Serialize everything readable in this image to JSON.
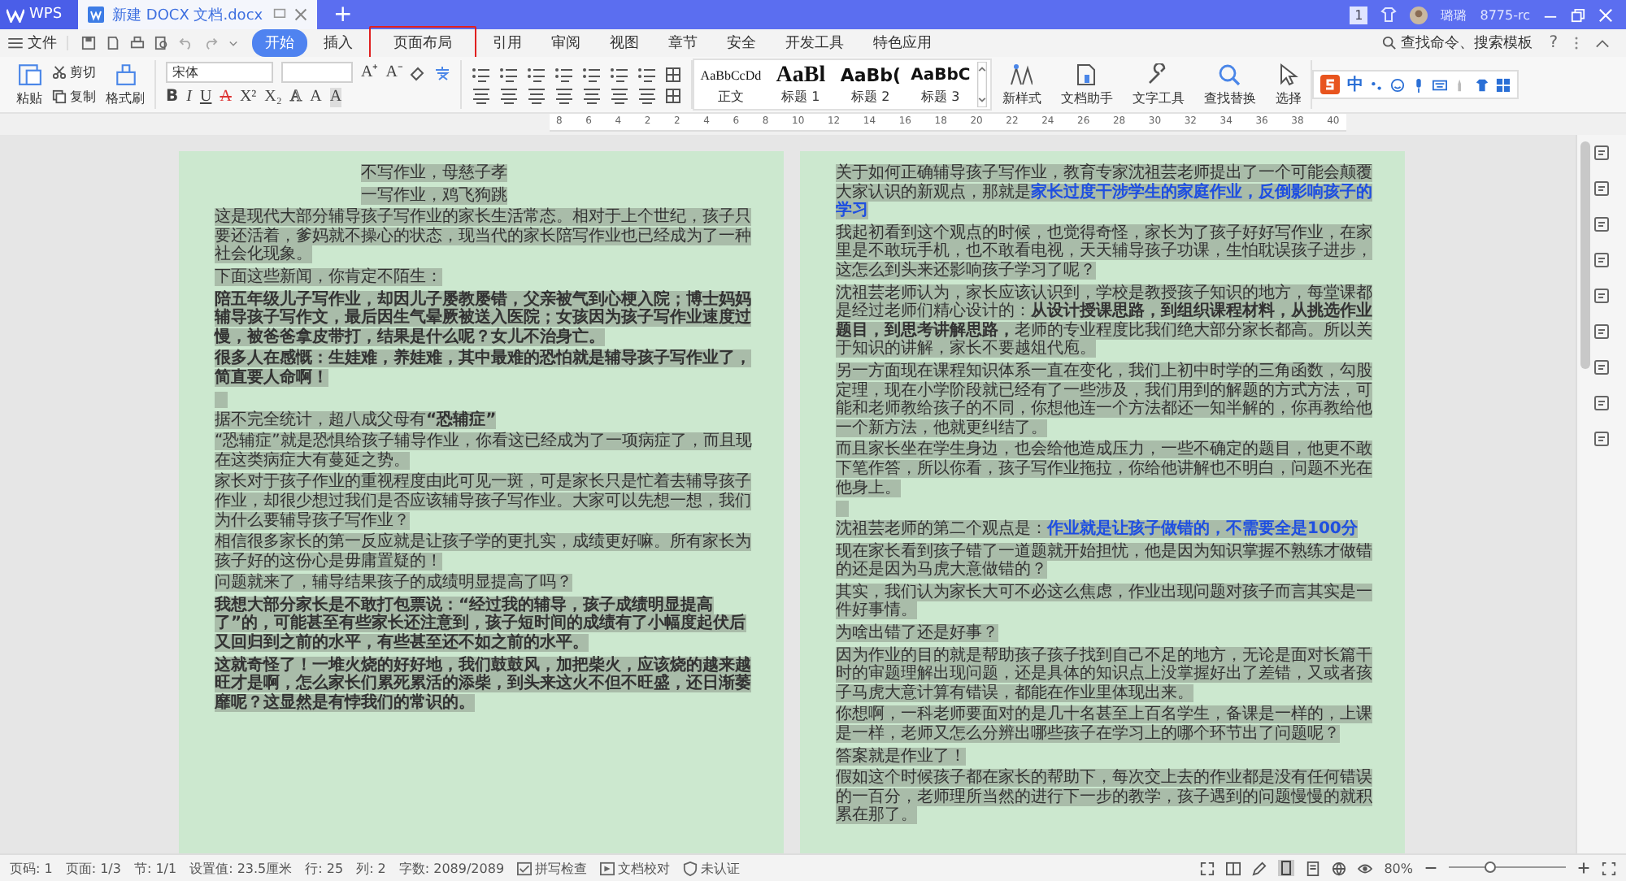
{
  "title_bar": {
    "app": "WPS",
    "doc_tab": "新建 DOCX 文档.docx",
    "new_tab": "+",
    "badge": "1",
    "user": "璐璐",
    "account": "8775-rc"
  },
  "menu": {
    "file": "文件",
    "tabs": [
      {
        "label": "开始",
        "selected": true,
        "annotated": false
      },
      {
        "label": "插入",
        "selected": false,
        "annotated": false
      },
      {
        "label": "页面布局",
        "selected": false,
        "annotated": true
      },
      {
        "label": "引用",
        "selected": false,
        "annotated": false
      },
      {
        "label": "审阅",
        "selected": false,
        "annotated": false
      },
      {
        "label": "视图",
        "selected": false,
        "annotated": false
      },
      {
        "label": "章节",
        "selected": false,
        "annotated": false
      },
      {
        "label": "安全",
        "selected": false,
        "annotated": false
      },
      {
        "label": "开发工具",
        "selected": false,
        "annotated": false
      },
      {
        "label": "特色应用",
        "selected": false,
        "annotated": false
      }
    ],
    "search": "查找命令、搜索模板",
    "help": "?"
  },
  "ribbon": {
    "paste": "粘贴",
    "cut": "剪切",
    "copy": "复制",
    "format_painter": "格式刷",
    "font_name": "宋体",
    "font_row1": [
      "A⁺",
      "A⁻"
    ],
    "font_row2": [
      {
        "glyph": "B",
        "kind": "bold"
      },
      {
        "glyph": "I",
        "kind": "italic"
      },
      {
        "glyph": "U",
        "kind": "underline"
      },
      {
        "glyph": "A",
        "kind": "strike"
      },
      {
        "glyph": "X²",
        "kind": "plain"
      },
      {
        "glyph": "X₂",
        "kind": "plain"
      },
      {
        "glyph": "A",
        "kind": "outline"
      },
      {
        "glyph": "A",
        "kind": "plain"
      },
      {
        "glyph": "A",
        "kind": "shaded"
      }
    ],
    "styles": [
      {
        "preview": "AaBbCcDd",
        "label": "正文",
        "kind": "normal"
      },
      {
        "preview": "AaBl",
        "label": "标题 1",
        "kind": "h1"
      },
      {
        "preview": "AaBb(",
        "label": "标题 2",
        "kind": "h2"
      },
      {
        "preview": "AaBbC",
        "label": "标题 3",
        "kind": "h3"
      }
    ],
    "new_style": "新样式",
    "doc_assistant": "文档助手",
    "text_tools": "文字工具",
    "find_replace": "查找替换",
    "select": "选择",
    "ime": "中"
  },
  "ruler": [
    "8",
    "6",
    "4",
    "2",
    "2",
    "4",
    "6",
    "8",
    "10",
    "12",
    "14",
    "16",
    "18",
    "20",
    "22",
    "24",
    "26",
    "28",
    "30",
    "32",
    "34",
    "36",
    "38",
    "40"
  ],
  "pages": [
    {
      "paragraphs": [
        {
          "kind": "center",
          "text": "不写作业，母慈子孝"
        },
        {
          "kind": "center",
          "text": "一写作业，鸡飞狗跳"
        },
        {
          "kind": "body",
          "text": "这是现代大部分辅导孩子写作业的家长生活常态。相对于上个世纪，孩子只要还活着，爹妈就不操心的状态，现当代的家长陪写作业也已经成为了一种社会化现象。"
        },
        {
          "kind": "body",
          "text": "下面这些新闻，你肯定不陌生："
        },
        {
          "kind": "bold",
          "text": "陪五年级儿子写作业，却因儿子屡教屡错，父亲被气到心梗入院；博士妈妈辅导孩子写作文，最后因生气晕厥被送入医院；女孩因为孩子写作业速度过慢，被爸爸拿皮带打，结果是什么呢？女儿不治身亡。"
        },
        {
          "kind": "bold",
          "text": "很多人在感慨：生娃难，养娃难，其中最难的恐怕就是辅导孩子写作业了，简直要人命啊！"
        },
        {
          "kind": "gap"
        },
        {
          "kind": "body",
          "text": "据不完全统计，超八成父母有**“恐辅症”**"
        },
        {
          "kind": "body",
          "text": "“恐辅症”就是恐惧给孩子辅导作业，你看这已经成为了一项病症了，而且现在这类病症大有蔓延之势。"
        },
        {
          "kind": "body",
          "text": "家长对于孩子作业的重视程度由此可见一斑，可是家长只是忙着去辅导孩子作业，却很少想过我们是否应该辅导孩子写作业。大家可以先想一想，我们为什么要辅导孩子写作业？"
        },
        {
          "kind": "body",
          "text": "相信很多家长的第一反应就是让孩子学的更扎实，成绩更好嘛。所有家长为孩子好的这份心是毋庸置疑的！"
        },
        {
          "kind": "body",
          "text": "问题就来了，辅导结果孩子的成绩明显提高了吗？"
        },
        {
          "kind": "bold",
          "text": "我想大部分家长是不敢打包票说：“经过我的辅导，孩子成绩明显提高了”的，可能甚至有些家长还注意到，孩子短时间的成绩有了小幅度起伏后又回归到之前的水平，有些甚至还不如之前的水平。"
        },
        {
          "kind": "bold",
          "text": "这就奇怪了！一堆火烧的好好地，我们鼓鼓风，加把柴火，应该烧的越来越旺才是啊，怎么家长们累死累活的添柴，到头来这火不但不旺盛，还日渐萎靡呢？这显然是有悖我们的常识的。"
        }
      ]
    },
    {
      "paragraphs": [
        {
          "kind": "body",
          "text": "关于如何正确辅导孩子写作业，教育专家沈祖芸老师提出了一个可能会颠覆大家认识的新观点，那就是",
          "emphasis": "家长过度干涉学生的家庭作业，反倒影响孩子的学习"
        },
        {
          "kind": "body",
          "text": "我起初看到这个观点的时候，也觉得奇怪，家长为了孩子好好写作业，在家里是不敢玩手机，也不敢看电视，天天辅导孩子功课，生怕耽误孩子进步，这怎么到头来还影响孩子学习了呢？"
        },
        {
          "kind": "body",
          "text": "沈祖芸老师认为，家长应该认识到，学校是教授孩子知识的地方，每堂课都是经过老师们精心设计的：**从设计授课思路，到组织课程材料，从挑选作业题目，到思考讲解思路，**老师的专业程度比我们绝大部分家长都高。所以关于知识的讲解，家长不要越俎代庖。"
        },
        {
          "kind": "body",
          "text": "另一方面现在课程知识体系一直在变化，我们上初中时学的三角函数，勾股定理，现在小学阶段就已经有了一些涉及，我们用到的解题的方式方法，可能和老师教给孩子的不同，你想他连一个方法都还一知半解的，你再教给他一个新方法，他就更纠结了。"
        },
        {
          "kind": "body",
          "text": "而且家长坐在学生身边，也会给他造成压力，一些不确定的题目，他更不敢下笔作答，所以你看，孩子写作业拖拉，你给他讲解也不明白，问题不光在他身上。"
        },
        {
          "kind": "gap"
        },
        {
          "kind": "body",
          "text": "沈祖芸老师的第二个观点是：",
          "emphasis": "作业就是让孩子做错的，不需要全是100分"
        },
        {
          "kind": "body",
          "text": "现在家长看到孩子错了一道题就开始担忧，他是因为知识掌握不熟练才做错的还是因为马虎大意做错的？"
        },
        {
          "kind": "body",
          "text": "其实，我们认为家长大可不必这么焦虑，作业出现问题对孩子而言其实是一件好事情。"
        },
        {
          "kind": "body",
          "text": "为啥出错了还是好事？"
        },
        {
          "kind": "body",
          "text": "因为作业的目的就是帮助孩子孩子找到自己不足的地方，无论是面对长篇干时的审题理解出现问题，还是具体的知识点上没掌握好出了差错，又或者孩子马虎大意计算有错误，都能在作业里体现出来。"
        },
        {
          "kind": "body",
          "text": "你想啊，一科老师要面对的是几十名甚至上百名学生，备课是一样的，上课是一样，老师又怎么分辨出哪些孩子在学习上的哪个环节出了问题呢？"
        },
        {
          "kind": "body",
          "text": "答案就是作业了！"
        },
        {
          "kind": "body",
          "text": "假如这个时候孩子都在家长的帮助下，每次交上去的作业都是没有任何错误的一百分，老师理所当然的进行下一步的教学，孩子遇到的问题慢慢的就积累在那了。"
        }
      ]
    }
  ],
  "status_bar": {
    "items": [
      "页码: 1",
      "页面: 1/3",
      "节: 1/1",
      "设置值: 23.5厘米",
      "行: 25",
      "列: 2",
      "字数: 2089/2089"
    ],
    "spell_check": "拼写检查",
    "proofread": "文档校对",
    "certification": "未认证",
    "zoom": "80%",
    "zoom_slider": {
      "level": 0.36
    }
  }
}
